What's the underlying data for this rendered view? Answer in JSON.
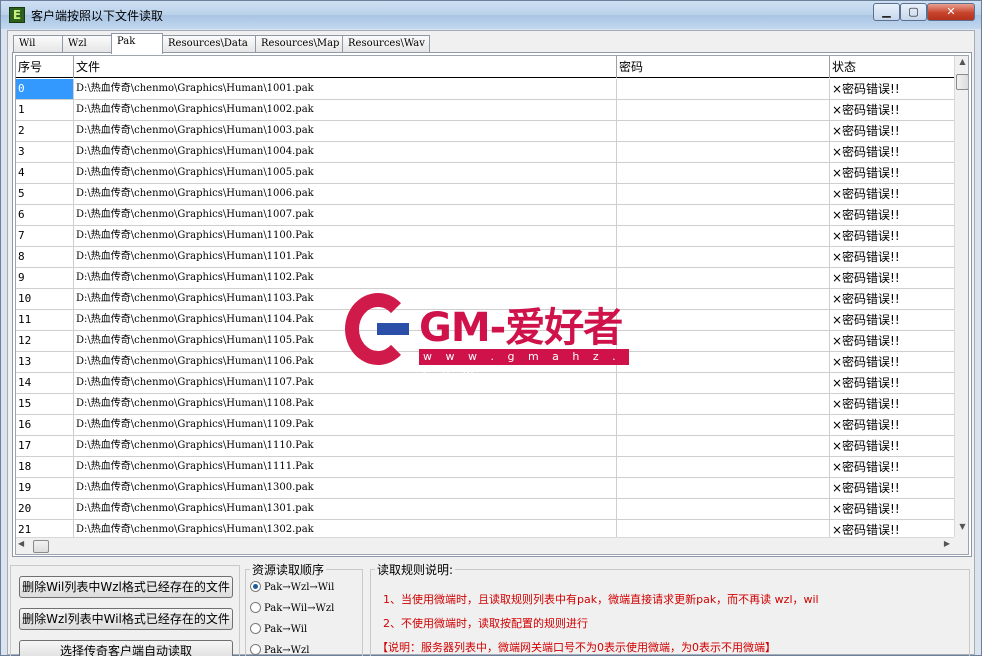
{
  "window": {
    "title": "客户端按照以下文件读取",
    "icon_letter": "E",
    "min_glyph": "▁",
    "max_glyph": "▢",
    "close_glyph": "✕"
  },
  "tabs": [
    {
      "label": "Wil"
    },
    {
      "label": "Wzl"
    },
    {
      "label": "Pak"
    },
    {
      "label": "Resources\\Data"
    },
    {
      "label": "Resources\\Map"
    },
    {
      "label": "Resources\\Wav"
    }
  ],
  "active_tab": "Pak",
  "table": {
    "columns": [
      "序号",
      "文件",
      "密码",
      "状态"
    ],
    "rows": [
      {
        "idx": "0",
        "file": "D:\\热血传奇\\chenmo\\Graphics\\Human\\1001.pak",
        "password": "",
        "status": "×密码错误!!"
      },
      {
        "idx": "1",
        "file": "D:\\热血传奇\\chenmo\\Graphics\\Human\\1002.pak",
        "password": "",
        "status": "×密码错误!!"
      },
      {
        "idx": "2",
        "file": "D:\\热血传奇\\chenmo\\Graphics\\Human\\1003.pak",
        "password": "",
        "status": "×密码错误!!"
      },
      {
        "idx": "3",
        "file": "D:\\热血传奇\\chenmo\\Graphics\\Human\\1004.pak",
        "password": "",
        "status": "×密码错误!!"
      },
      {
        "idx": "4",
        "file": "D:\\热血传奇\\chenmo\\Graphics\\Human\\1005.pak",
        "password": "",
        "status": "×密码错误!!"
      },
      {
        "idx": "5",
        "file": "D:\\热血传奇\\chenmo\\Graphics\\Human\\1006.pak",
        "password": "",
        "status": "×密码错误!!"
      },
      {
        "idx": "6",
        "file": "D:\\热血传奇\\chenmo\\Graphics\\Human\\1007.pak",
        "password": "",
        "status": "×密码错误!!"
      },
      {
        "idx": "7",
        "file": "D:\\热血传奇\\chenmo\\Graphics\\Human\\1100.Pak",
        "password": "",
        "status": "×密码错误!!"
      },
      {
        "idx": "8",
        "file": "D:\\热血传奇\\chenmo\\Graphics\\Human\\1101.Pak",
        "password": "",
        "status": "×密码错误!!"
      },
      {
        "idx": "9",
        "file": "D:\\热血传奇\\chenmo\\Graphics\\Human\\1102.Pak",
        "password": "",
        "status": "×密码错误!!"
      },
      {
        "idx": "10",
        "file": "D:\\热血传奇\\chenmo\\Graphics\\Human\\1103.Pak",
        "password": "",
        "status": "×密码错误!!"
      },
      {
        "idx": "11",
        "file": "D:\\热血传奇\\chenmo\\Graphics\\Human\\1104.Pak",
        "password": "",
        "status": "×密码错误!!"
      },
      {
        "idx": "12",
        "file": "D:\\热血传奇\\chenmo\\Graphics\\Human\\1105.Pak",
        "password": "",
        "status": "×密码错误!!"
      },
      {
        "idx": "13",
        "file": "D:\\热血传奇\\chenmo\\Graphics\\Human\\1106.Pak",
        "password": "",
        "status": "×密码错误!!"
      },
      {
        "idx": "14",
        "file": "D:\\热血传奇\\chenmo\\Graphics\\Human\\1107.Pak",
        "password": "",
        "status": "×密码错误!!"
      },
      {
        "idx": "15",
        "file": "D:\\热血传奇\\chenmo\\Graphics\\Human\\1108.Pak",
        "password": "",
        "status": "×密码错误!!"
      },
      {
        "idx": "16",
        "file": "D:\\热血传奇\\chenmo\\Graphics\\Human\\1109.Pak",
        "password": "",
        "status": "×密码错误!!"
      },
      {
        "idx": "17",
        "file": "D:\\热血传奇\\chenmo\\Graphics\\Human\\1110.Pak",
        "password": "",
        "status": "×密码错误!!"
      },
      {
        "idx": "18",
        "file": "D:\\热血传奇\\chenmo\\Graphics\\Human\\1111.Pak",
        "password": "",
        "status": "×密码错误!!"
      },
      {
        "idx": "19",
        "file": "D:\\热血传奇\\chenmo\\Graphics\\Human\\1300.pak",
        "password": "",
        "status": "×密码错误!!"
      },
      {
        "idx": "20",
        "file": "D:\\热血传奇\\chenmo\\Graphics\\Human\\1301.pak",
        "password": "",
        "status": "×密码错误!!"
      },
      {
        "idx": "21",
        "file": "D:\\热血传奇\\chenmo\\Graphics\\Human\\1302.pak",
        "password": "",
        "status": "×密码错误!!"
      }
    ],
    "selected_index": "0"
  },
  "scroll": {
    "up": "▲",
    "down": "▼",
    "left": "◀",
    "right": "▶"
  },
  "buttons": {
    "delete_wil": "删除Wil列表中Wzl格式已经存在的文件",
    "delete_wzl": "删除Wzl列表中Wil格式已经存在的文件",
    "choose_client": "选择传奇客户端自动读取"
  },
  "read_order": {
    "title": "资源读取顺序",
    "options": [
      {
        "label": "Pak→Wzl→Wil",
        "selected": true
      },
      {
        "label": "Pak→Wil→Wzl",
        "selected": false
      },
      {
        "label": "Pak→Wil",
        "selected": false
      },
      {
        "label": "Pak→Wzl",
        "selected": false
      }
    ]
  },
  "rules": {
    "title": "读取规则说明:",
    "lines": [
      "1、当使用微端时，且读取规则列表中有pak，微端直接请求更新pak，而不再读 wzl，wil",
      "2、不使用微端时，读取按配置的规则进行",
      "【说明：服务器列表中，微端网关端口号不为0表示使用微端，为0表示不用微端】"
    ]
  },
  "watermark": {
    "brand": "GM-爱好者",
    "url": "w w w . g m a h z . c o m"
  }
}
